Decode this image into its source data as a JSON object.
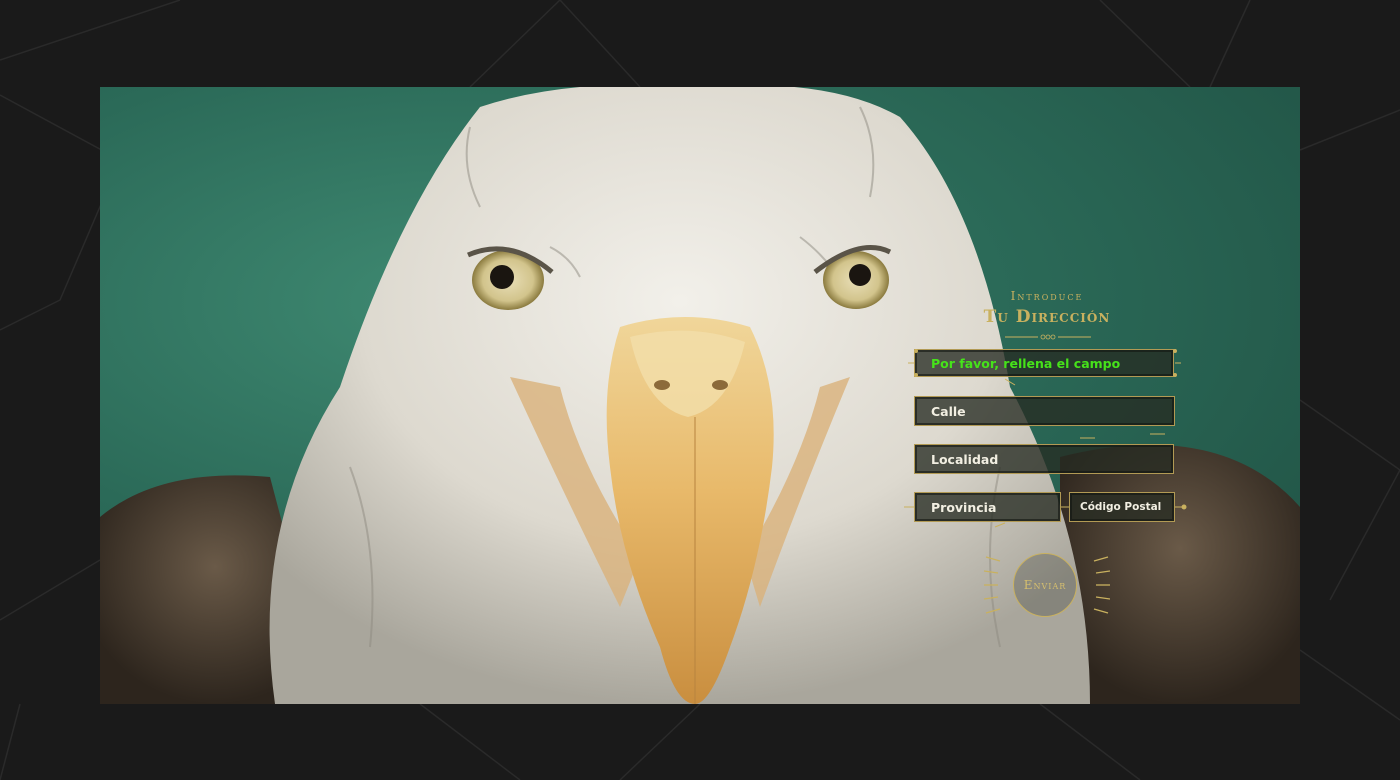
{
  "form": {
    "title_small": "Introduce",
    "title_big": "Tu Dirección",
    "fields": {
      "name_error": "Por favor, rellena el campo",
      "calle": "Calle",
      "localidad": "Localidad",
      "provincia": "Provincia",
      "codigo_postal": "Código Postal"
    },
    "submit_label": "Enviar"
  },
  "colors": {
    "gold": "#c9b15f",
    "error_text": "#46e21a",
    "page_background": "#1a1a1a",
    "photo_background": "#2b6a58"
  },
  "icons": [
    "eagle-photo",
    "ornament-divider-icon",
    "send-rays-icon"
  ]
}
